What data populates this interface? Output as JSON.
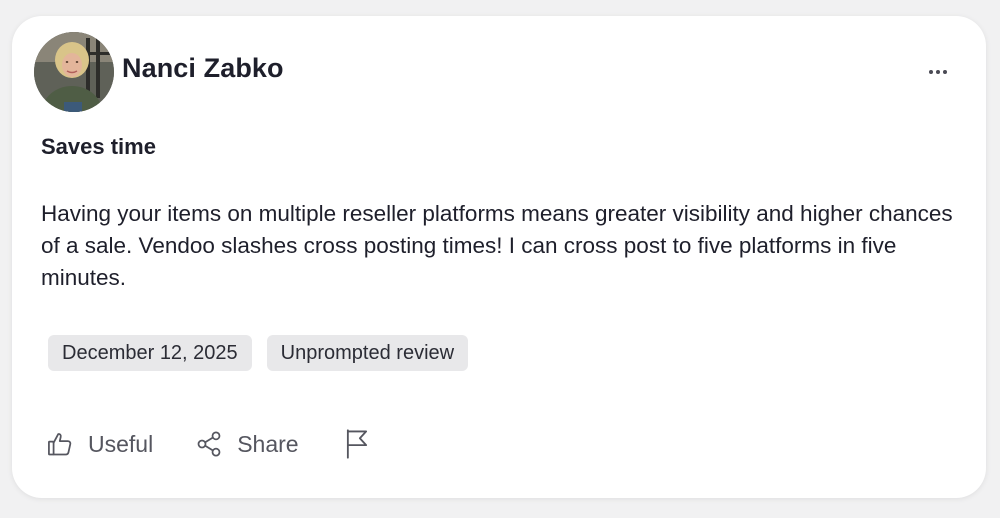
{
  "review": {
    "author": "Nanci Zabko",
    "title": "Saves time",
    "body": "Having your items on multiple reseller platforms means greater visibility and higher chances of a sale. Vendoo slashes cross posting times! I can cross post to five platforms in five minutes.",
    "tags": [
      "December 12, 2025",
      "Unprompted review"
    ]
  },
  "actions": {
    "useful_label": "Useful",
    "share_label": "Share"
  },
  "icons": {
    "more": "more-horizontal-icon",
    "useful": "thumbs-up-icon",
    "share": "share-icon",
    "report": "flag-icon"
  }
}
